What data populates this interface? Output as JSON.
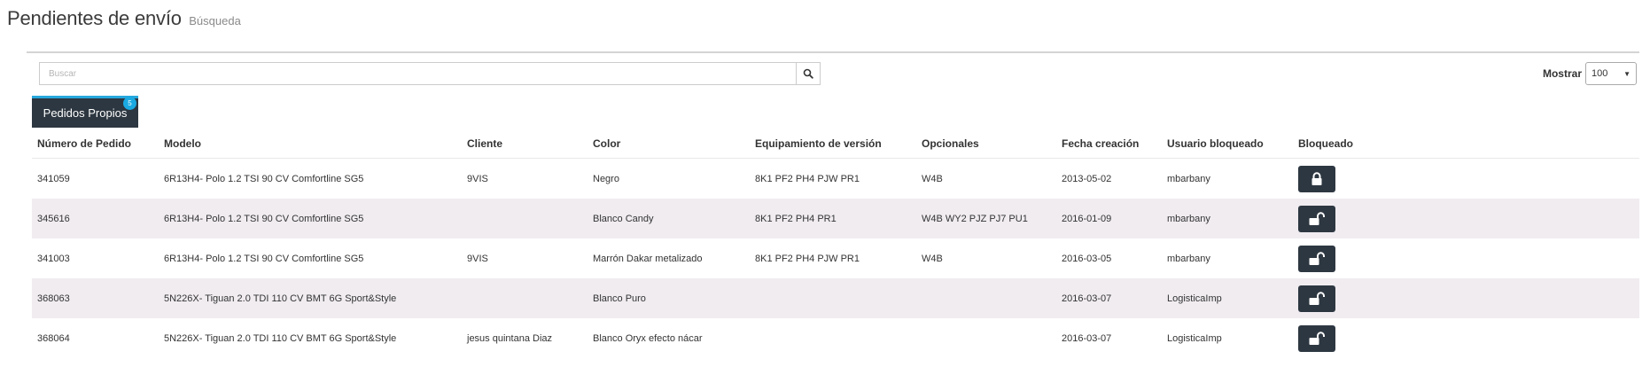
{
  "header": {
    "title": "Pendientes de envío",
    "subtitle": "Búsqueda"
  },
  "search": {
    "placeholder": "Buscar",
    "value": "",
    "button_icon": "search-icon"
  },
  "page_size": {
    "label": "Mostrar",
    "selected": "100",
    "caret_icon": "caret-down-icon"
  },
  "tabs": [
    {
      "label": "Pedidos Propios",
      "badge": "5",
      "active": true
    }
  ],
  "table": {
    "columns": [
      "Número de Pedido",
      "Modelo",
      "Cliente",
      "Color",
      "Equipamiento de versión",
      "Opcionales",
      "Fecha creación",
      "Usuario bloqueado",
      "Bloqueado"
    ],
    "rows": [
      {
        "numero": "341059",
        "modelo": "6R13H4- Polo 1.2 TSI 90 CV Comfortline SG5",
        "cliente": "9VIS",
        "color": "Negro",
        "equipamiento": "8K1 PF2 PH4 PJW PR1",
        "opcionales": "W4B",
        "fecha": "2013-05-02",
        "usuario": "mbarbany",
        "bloqueado": true,
        "lock_icon": "lock-closed-icon"
      },
      {
        "numero": "345616",
        "modelo": "6R13H4- Polo 1.2 TSI 90 CV Comfortline SG5",
        "cliente": "",
        "color": "Blanco Candy",
        "equipamiento": "8K1 PF2 PH4 PR1",
        "opcionales": "W4B WY2 PJZ PJ7 PU1",
        "fecha": "2016-01-09",
        "usuario": "mbarbany",
        "bloqueado": false,
        "lock_icon": "lock-open-icon"
      },
      {
        "numero": "341003",
        "modelo": "6R13H4- Polo 1.2 TSI 90 CV Comfortline SG5",
        "cliente": "9VIS",
        "color": "Marrón Dakar metalizado",
        "equipamiento": "8K1 PF2 PH4 PJW PR1",
        "opcionales": "W4B",
        "fecha": "2016-03-05",
        "usuario": "mbarbany",
        "bloqueado": false,
        "lock_icon": "lock-open-icon"
      },
      {
        "numero": "368063",
        "modelo": "5N226X- Tiguan 2.0 TDI 110 CV BMT 6G Sport&Style",
        "cliente": "",
        "color": "Blanco Puro",
        "equipamiento": "",
        "opcionales": "",
        "fecha": "2016-03-07",
        "usuario": "LogisticaImp",
        "bloqueado": false,
        "lock_icon": "lock-open-icon"
      },
      {
        "numero": "368064",
        "modelo": "5N226X- Tiguan 2.0 TDI 110 CV BMT 6G Sport&Style",
        "cliente": "jesus quintana Diaz",
        "color": "Blanco Oryx efecto nácar",
        "equipamiento": "",
        "opcionales": "",
        "fecha": "2016-03-07",
        "usuario": "LogisticaImp",
        "bloqueado": false,
        "lock_icon": "lock-open-icon"
      }
    ]
  },
  "colors": {
    "accent": "#26a7dc",
    "dark_button": "#2d3741",
    "zebra_row": "#f0ecf0"
  }
}
